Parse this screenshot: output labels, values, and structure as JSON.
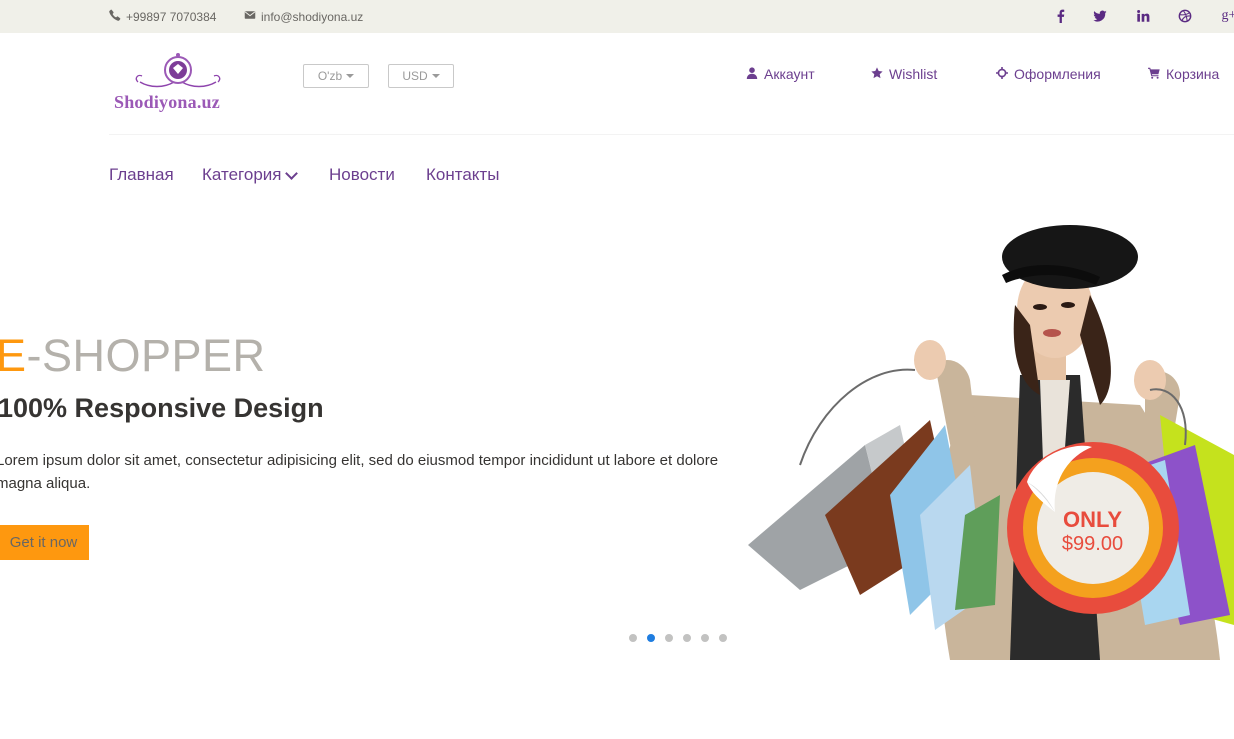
{
  "topbar": {
    "phone": "+99897 7070384",
    "email": "info@shodiyona.uz",
    "social": [
      "facebook-icon",
      "twitter-icon",
      "linkedin-icon",
      "dribbble-icon",
      "google-plus-icon"
    ],
    "gplus_label": "g+"
  },
  "header": {
    "logo_text": "Shodiyona.uz",
    "language": "O'zb",
    "currency": "USD",
    "links": {
      "account": "Аккаунт",
      "wishlist": "Wishlist",
      "checkout": "Оформления",
      "cart": "Корзина"
    }
  },
  "nav": {
    "home": "Главная",
    "category": "Категория",
    "news": "Новости",
    "contacts": "Контакты"
  },
  "slider": {
    "title_accent": "E",
    "title_rest": "-SHOPPER",
    "subtitle": "100% Responsive Design",
    "text": "Lorem ipsum dolor sit amet, consectetur adipisicing elit, sed do eiusmod tempor incididunt ut labore et dolore magna aliqua.",
    "button": "Get it now",
    "dots_count": 6,
    "active_dot": 2,
    "badge_only": "ONLY",
    "badge_price": "$99.00"
  },
  "colors": {
    "accent": "#fe980f",
    "brand_purple": "#6c3f8f",
    "topbar_bg": "#f0f0e9",
    "badge_red": "#e84c3d",
    "active_dot": "#1f7de0"
  }
}
